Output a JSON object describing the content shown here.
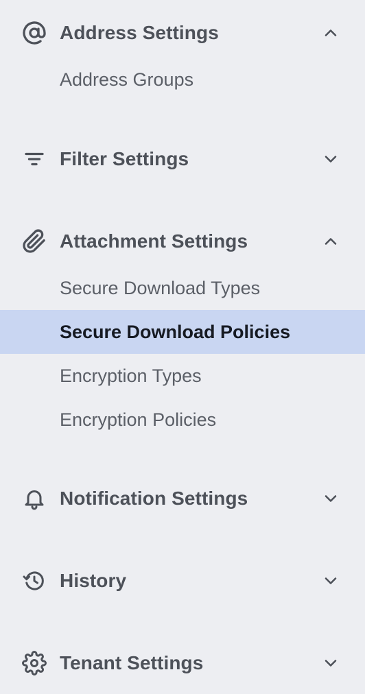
{
  "colors": {
    "background": "#edeef2",
    "active_background": "#c9d6f2",
    "text": "#4d5159",
    "active_text": "#161a22"
  },
  "sections": {
    "address": {
      "label": "Address Settings",
      "icon": "at-sign-icon",
      "expanded": true,
      "items": [
        "Address Groups"
      ]
    },
    "filter": {
      "label": "Filter Settings",
      "icon": "filter-icon",
      "expanded": false
    },
    "attachment": {
      "label": "Attachment Settings",
      "icon": "paperclip-icon",
      "expanded": true,
      "items": [
        "Secure Download Types",
        "Secure Download Policies",
        "Encryption Types",
        "Encryption Policies"
      ],
      "active_item": "Secure Download Policies"
    },
    "notification": {
      "label": "Notification Settings",
      "icon": "bell-icon",
      "expanded": false
    },
    "history": {
      "label": "History",
      "icon": "history-icon",
      "expanded": false
    },
    "tenant": {
      "label": "Tenant Settings",
      "icon": "gear-icon",
      "expanded": false
    }
  }
}
